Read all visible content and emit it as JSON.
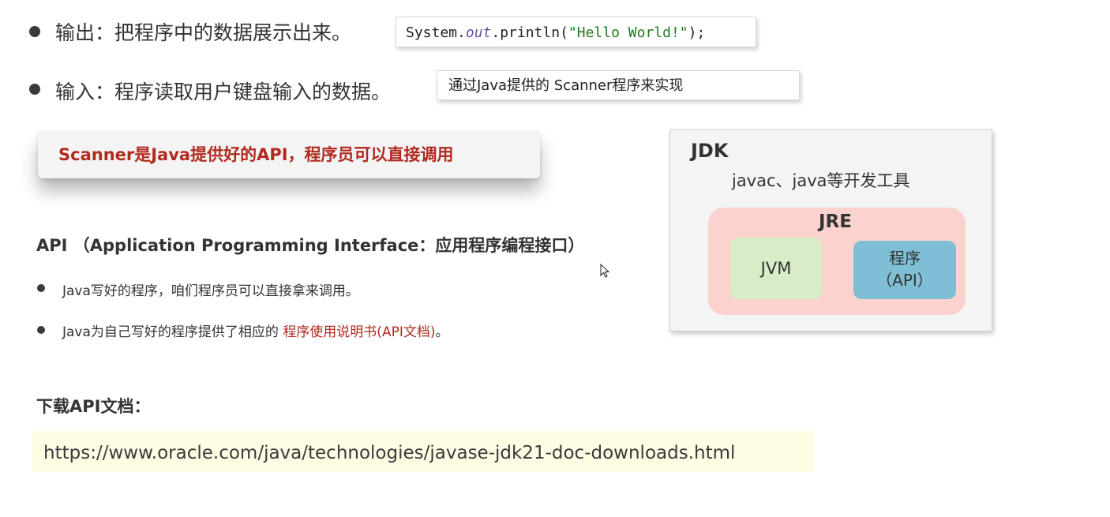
{
  "output_bullet": {
    "label": "输出：把程序中的数据展示出来。",
    "code": {
      "prefix": "System.",
      "field": "out",
      "method": ".println(",
      "string": "\"Hello World!\"",
      "suffix": ");"
    }
  },
  "input_bullet": {
    "label": "输入：程序读取用户键盘输入的数据。",
    "note": "通过Java提供的 Scanner程序来实现"
  },
  "callout": {
    "text": "Scanner是Java提供好的API，程序员可以直接调用"
  },
  "jdk_diagram": {
    "jdk_title": "JDK",
    "tools": "javac、java等开发工具",
    "jre_title": "JRE",
    "jvm_label": "JVM",
    "api_line1": "程序",
    "api_line2": "（API）"
  },
  "api_section": {
    "heading": "API （Application Programming Interface：应用程序编程接口）",
    "items": [
      {
        "text": "Java写好的程序，咱们程序员可以直接拿来调用。"
      },
      {
        "text": "Java为自己写好的程序提供了相应的 ",
        "highlight": "程序使用说明书(API文档)",
        "suffix": "。"
      }
    ]
  },
  "download": {
    "heading": "下载API文档：",
    "url": "https://www.oracle.com/java/technologies/javase-jdk21-doc-downloads.html"
  },
  "colors": {
    "accent_red": "#b12a1f",
    "code_keyword": "#6b4fa0",
    "code_string": "#1f7a1f",
    "jre_pink": "#fcd2cf",
    "jvm_green": "#d9ecc8",
    "api_blue": "#7fbfd6",
    "url_bg": "#fffce4"
  }
}
